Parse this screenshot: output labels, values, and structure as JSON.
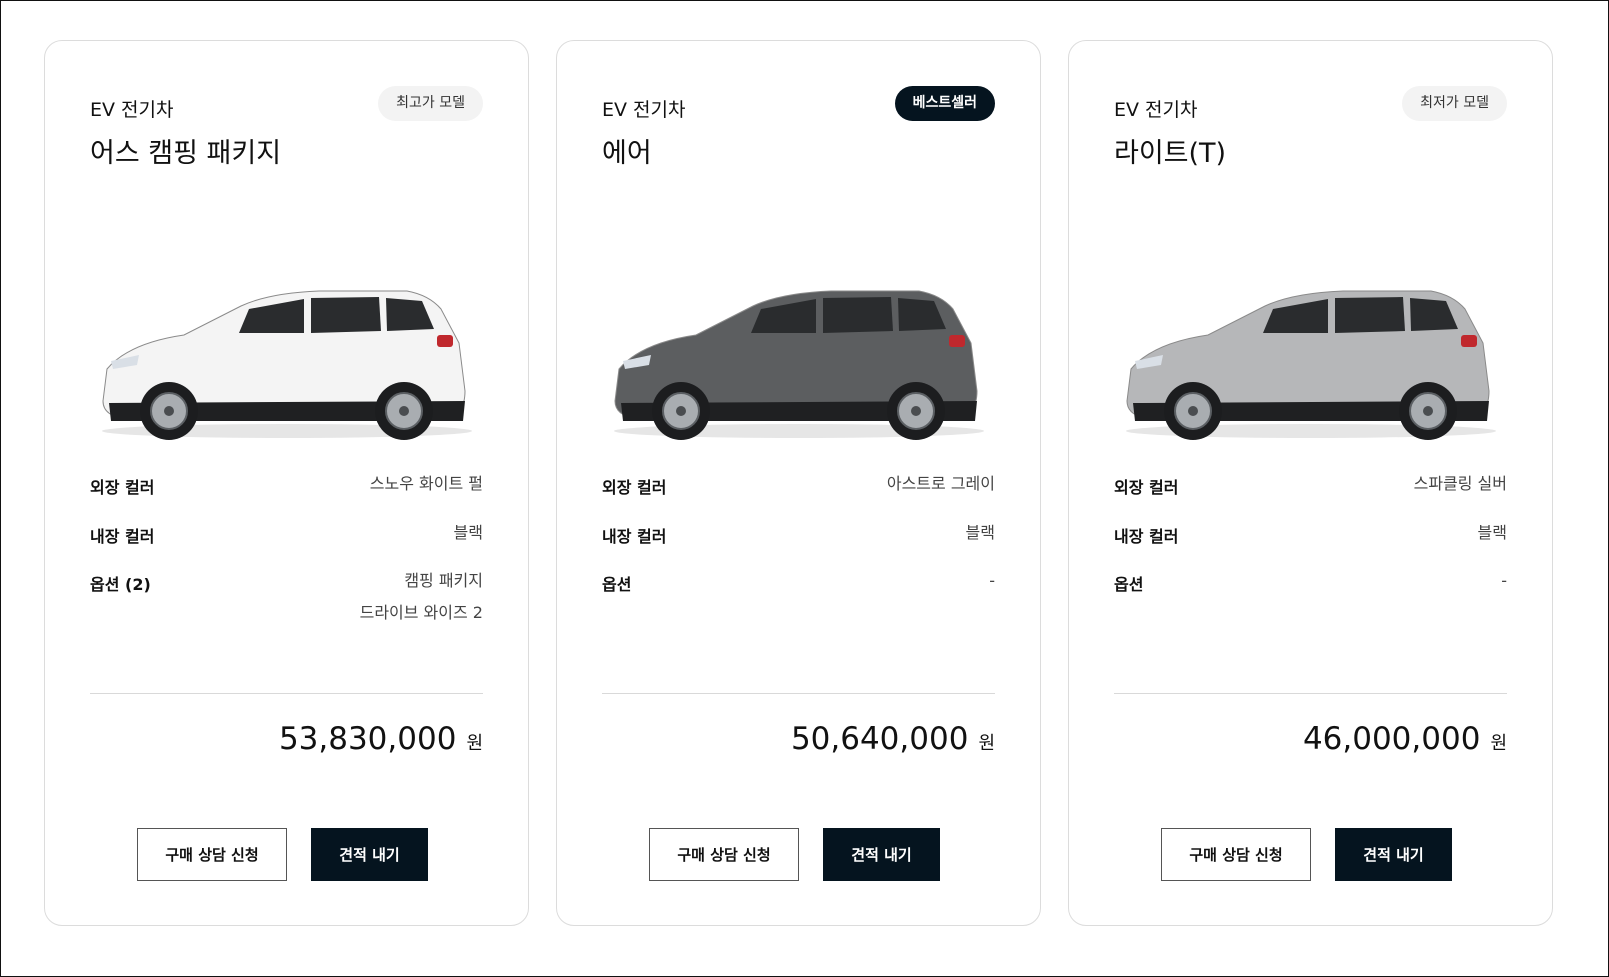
{
  "cards": [
    {
      "category": "EV 전기차",
      "model": "어스 캠핑 패키지",
      "badge": "최고가 모델",
      "badge_style": "light",
      "car_color": "#f4f4f4",
      "specs": {
        "exterior_label": "외장 컬러",
        "exterior_value": "스노우 화이트 펄",
        "interior_label": "내장 컬러",
        "interior_value": "블랙",
        "options_label": "옵션 (2)",
        "options_values": [
          "캠핑 패키지",
          "드라이브 와이즈 2"
        ]
      },
      "price": "53,830,000",
      "currency": "원",
      "consult_button": "구매 상담 신청",
      "quote_button": "견적 내기"
    },
    {
      "category": "EV 전기차",
      "model": "에어",
      "badge": "베스트셀러",
      "badge_style": "dark",
      "car_color": "#5c5e60",
      "specs": {
        "exterior_label": "외장 컬러",
        "exterior_value": "아스트로 그레이",
        "interior_label": "내장 컬러",
        "interior_value": "블랙",
        "options_label": "옵션",
        "options_values": [
          "-"
        ]
      },
      "price": "50,640,000",
      "currency": "원",
      "consult_button": "구매 상담 신청",
      "quote_button": "견적 내기"
    },
    {
      "category": "EV 전기차",
      "model": "라이트(T)",
      "badge": "최저가 모델",
      "badge_style": "light",
      "car_color": "#b6b7b9",
      "specs": {
        "exterior_label": "외장 컬러",
        "exterior_value": "스파클링 실버",
        "interior_label": "내장 컬러",
        "interior_value": "블랙",
        "options_label": "옵션",
        "options_values": [
          "-"
        ]
      },
      "price": "46,000,000",
      "currency": "원",
      "consult_button": "구매 상담 신청",
      "quote_button": "견적 내기"
    }
  ]
}
